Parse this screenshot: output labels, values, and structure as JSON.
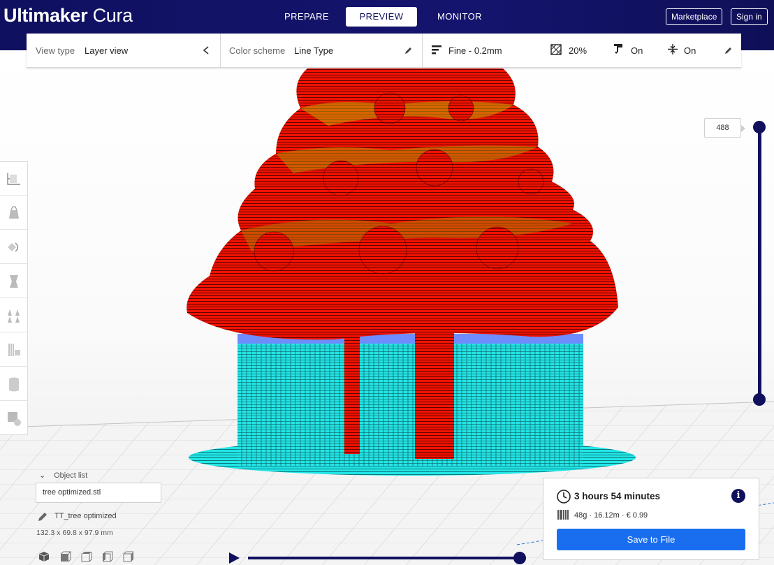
{
  "app": {
    "logo_bold": "Ultimaker",
    "logo_light": "Cura"
  },
  "stages": [
    {
      "label": "PREPARE",
      "active": false
    },
    {
      "label": "PREVIEW",
      "active": true
    },
    {
      "label": "MONITOR",
      "active": false
    }
  ],
  "header_buttons": {
    "marketplace": "Marketplace",
    "signin": "Sign in"
  },
  "toolbar": {
    "view_type_label": "View type",
    "view_type_value": "Layer view",
    "color_scheme_label": "Color scheme",
    "color_scheme_value": "Line Type",
    "profile": "Fine - 0.2mm",
    "infill": "20%",
    "support": "On",
    "adhesion": "On"
  },
  "left_tools": [
    "move-tool-icon",
    "scale-tool-icon",
    "rotate-tool-icon",
    "mirror-tool-icon",
    "per-model-settings-icon",
    "support-blocker-icon",
    "cylinder-icon",
    "custom-support-icon"
  ],
  "layer_slider": {
    "current_layer": "488",
    "position_fraction": 1.0
  },
  "object_list": {
    "toggle_label": "Object list",
    "file_name": "tree optimized.stl",
    "object_name": "TT_tree optimized",
    "dimensions": "132.3 x 69.8 x 97.9 mm"
  },
  "print_info": {
    "time": "3 hours 54 minutes",
    "material": "48g · 16.12m · € 0.99",
    "save_label": "Save to File",
    "info_label": "i"
  },
  "path_slider": {
    "position_fraction": 1.0
  },
  "colors": {
    "header": "#12126a",
    "accent": "#196ef0",
    "wall": "#ff1a00",
    "support": "#1ee8e8",
    "infill": "#c8b400"
  }
}
